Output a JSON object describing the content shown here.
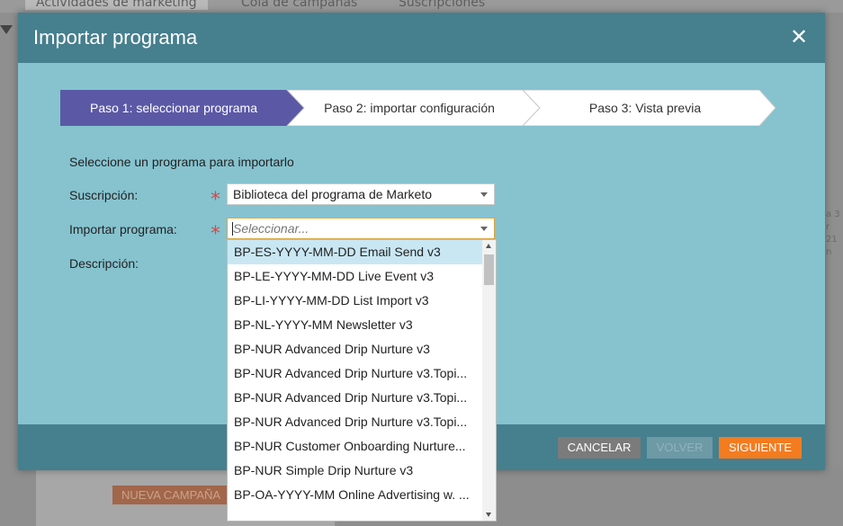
{
  "background": {
    "tabs": [
      "Actividades de marketing",
      "Cola de campañas",
      "Suscripciones"
    ],
    "new_campaign_button": "NUEVA CAMPAÑA",
    "side_text": [
      "a 3 r",
      "21 n"
    ]
  },
  "modal": {
    "title": "Importar programa",
    "close_icon": "close-icon",
    "steps": [
      {
        "label": "Paso 1: seleccionar programa",
        "active": true
      },
      {
        "label": "Paso 2: importar configuración",
        "active": false
      },
      {
        "label": "Paso 3: Vista previa",
        "active": false
      }
    ],
    "intro": "Seleccione un programa para importarlo",
    "form": {
      "subscription_label": "Suscripción:",
      "subscription_value": "Biblioteca del programa de Marketo",
      "program_label": "Importar programa:",
      "program_placeholder": "Seleccionar...",
      "description_label": "Descripción:"
    },
    "dropdown_options": [
      "BP-ES-YYYY-MM-DD Email Send v3",
      "BP-LE-YYYY-MM-DD Live Event v3",
      "BP-LI-YYYY-MM-DD List Import v3",
      "BP-NL-YYYY-MM Newsletter v3",
      "BP-NUR Advanced Drip Nurture v3",
      "BP-NUR Advanced Drip Nurture v3.Topi...",
      "BP-NUR Advanced Drip Nurture v3.Topi...",
      "BP-NUR Advanced Drip Nurture v3.Topi...",
      "BP-NUR Customer Onboarding Nurture...",
      "BP-NUR Simple Drip Nurture v3",
      "BP-OA-YYYY-MM Online Advertising w. ..."
    ],
    "buttons": {
      "cancel": "CANCELAR",
      "back": "VOLVER",
      "next": "SIGUIENTE"
    }
  },
  "colors": {
    "header": "#467f8e",
    "body": "#86c3cf",
    "active_step": "#5b59a6",
    "next_button": "#f47c20",
    "required": "#d24a4a"
  }
}
